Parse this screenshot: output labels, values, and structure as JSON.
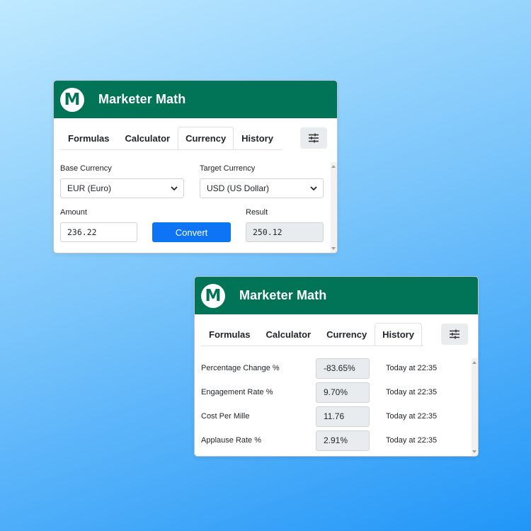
{
  "app": {
    "title": "Marketer Math",
    "logo_letter": "M",
    "brand_color": "#017356"
  },
  "tabs": [
    "Formulas",
    "Calculator",
    "Currency",
    "History"
  ],
  "currency_panel": {
    "active_tab": "Currency",
    "base_label": "Base Currency",
    "base_value": "EUR (Euro)",
    "target_label": "Target Currency",
    "target_value": "USD (US Dollar)",
    "amount_label": "Amount",
    "amount_value": "236.22",
    "convert_label": "Convert",
    "result_label": "Result",
    "result_value": "250.12"
  },
  "history_panel": {
    "active_tab": "History",
    "rows": [
      {
        "name": "Percentage Change %",
        "value": "-83.65%",
        "time": "Today at 22:35"
      },
      {
        "name": "Engagement Rate %",
        "value": "9.70%",
        "time": "Today at 22:35"
      },
      {
        "name": "Cost Per Mille",
        "value": "11.76",
        "time": "Today at 22:35"
      },
      {
        "name": "Applause Rate %",
        "value": "2.91%",
        "time": "Today at 22:35"
      }
    ]
  }
}
